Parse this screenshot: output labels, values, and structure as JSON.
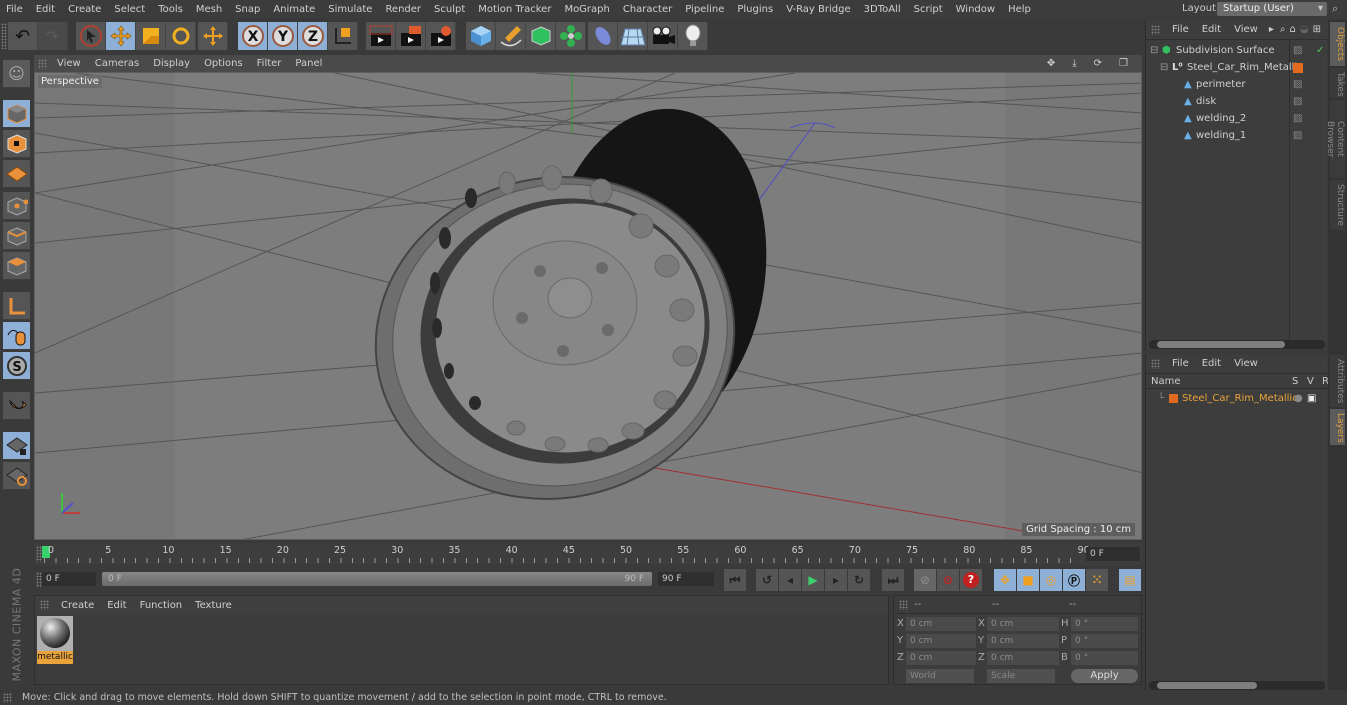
{
  "menubar": {
    "items": [
      "File",
      "Edit",
      "Create",
      "Select",
      "Tools",
      "Mesh",
      "Snap",
      "Animate",
      "Simulate",
      "Render",
      "Sculpt",
      "Motion Tracker",
      "MoGraph",
      "Character",
      "Pipeline",
      "Plugins",
      "V-Ray Bridge",
      "3DToAll",
      "Script",
      "Window",
      "Help"
    ],
    "layout_label": "Layout:",
    "layout_value": "Startup (User)"
  },
  "toolbar": {
    "icons": [
      "undo-icon",
      "redo-icon",
      "live-selection-icon",
      "move-icon",
      "scale-icon",
      "rotate-icon",
      "recent-tool-icon",
      "x-axis-icon",
      "y-axis-icon",
      "z-axis-icon",
      "coordinate-system-icon",
      "render-view-icon",
      "render-picture-viewer-icon",
      "edit-render-settings-icon",
      "cube-icon",
      "pen-spline-icon",
      "subdivision-surface-icon",
      "cloner-icon",
      "deformer-icon",
      "floor-icon",
      "camera-icon",
      "light-icon"
    ]
  },
  "viewport": {
    "menu": [
      "View",
      "Cameras",
      "Display",
      "Options",
      "Filter",
      "Panel"
    ],
    "camera_label": "Perspective",
    "grid_spacing": "Grid Spacing : 10 cm",
    "scene_object": "steel car rim"
  },
  "timeline": {
    "ticks": [
      "0",
      "5",
      "10",
      "15",
      "20",
      "25",
      "30",
      "35",
      "40",
      "45",
      "50",
      "55",
      "60",
      "65",
      "70",
      "75",
      "80",
      "85",
      "90"
    ],
    "current_frame": "0 F",
    "start_frame": "0 F",
    "range_start": "0 F",
    "range_end": "90 F",
    "end_frame": "90 F"
  },
  "material_manager": {
    "menu": [
      "Create",
      "Edit",
      "Function",
      "Texture"
    ],
    "materials": [
      {
        "name": "metallic",
        "selected": true
      }
    ]
  },
  "coordinates": {
    "headers": [
      "--",
      "--",
      "--"
    ],
    "rows": [
      {
        "l1": "X",
        "v1": "0 cm",
        "l2": "X",
        "v2": "0 cm",
        "l3": "H",
        "v3": "0 °"
      },
      {
        "l1": "Y",
        "v1": "0 cm",
        "l2": "Y",
        "v2": "0 cm",
        "l3": "P",
        "v3": "0 °"
      },
      {
        "l1": "Z",
        "v1": "0 cm",
        "l2": "Z",
        "v2": "0 cm",
        "l3": "B",
        "v3": "0 °"
      }
    ],
    "mode_select": "World",
    "size_select": "Scale",
    "apply_label": "Apply"
  },
  "object_manager": {
    "menu": [
      "File",
      "Edit",
      "View"
    ],
    "objects": [
      {
        "name": "Subdivision Surface",
        "level": 0,
        "type": "subdivision"
      },
      {
        "name": "Steel_Car_Rim_Metallic",
        "level": 1,
        "type": "null"
      },
      {
        "name": "perimeter",
        "level": 2,
        "type": "polygon"
      },
      {
        "name": "disk",
        "level": 2,
        "type": "polygon"
      },
      {
        "name": "welding_2",
        "level": 2,
        "type": "polygon"
      },
      {
        "name": "welding_1",
        "level": 2,
        "type": "polygon"
      }
    ]
  },
  "layer_manager": {
    "menu": [
      "File",
      "Edit",
      "View"
    ],
    "columns": [
      "Name",
      "S",
      "V",
      "R"
    ],
    "layers": [
      {
        "name": "Steel_Car_Rim_Metallic",
        "color": "#e06a20"
      }
    ]
  },
  "side_tabs": {
    "top": [
      "Objects",
      "Takes",
      "Content Browser",
      "Structure"
    ],
    "bottom": [
      "Attributes",
      "Layers"
    ]
  },
  "brand": "MAXON CINEMA 4D",
  "status": "Move: Click and drag to move elements. Hold down SHIFT to quantize movement / add to the selection in point mode, CTRL to remove.",
  "colors": {
    "accent": "#e8a33a",
    "selected_blue": "#8fb0d6",
    "layer_orange": "#e06a20"
  }
}
